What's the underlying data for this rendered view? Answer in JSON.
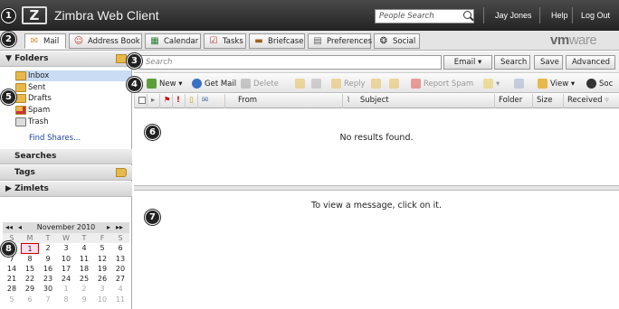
{
  "header": {
    "logo_text": "Z",
    "app_title": "Zimbra Web Client",
    "people_search_placeholder": "People Search",
    "user": "Jay Jones",
    "help": "Help",
    "logout": "Log Out"
  },
  "tabs": [
    {
      "label": "Mail",
      "icon": "mail-icon"
    },
    {
      "label": "Address Book",
      "icon": "address-book-icon"
    },
    {
      "label": "Calendar",
      "icon": "calendar-icon"
    },
    {
      "label": "Tasks",
      "icon": "tasks-icon"
    },
    {
      "label": "Briefcase",
      "icon": "briefcase-icon"
    },
    {
      "label": "Preferences",
      "icon": "preferences-icon"
    },
    {
      "label": "Social",
      "icon": "social-icon"
    }
  ],
  "brand": {
    "vm": "vm",
    "ware": "ware"
  },
  "sidebar": {
    "folders_header": "Folders",
    "folders": [
      "Inbox",
      "Sent",
      "Drafts",
      "Spam",
      "Trash"
    ],
    "find_shares": "Find Shares...",
    "searches": "Searches",
    "tags": "Tags",
    "zimlets": "Zimlets"
  },
  "calendar": {
    "month_label": "November 2010",
    "dow": [
      "S",
      "M",
      "T",
      "W",
      "T",
      "F",
      "S"
    ],
    "weeks": [
      [
        "31",
        "1",
        "2",
        "3",
        "4",
        "5",
        "6"
      ],
      [
        "7",
        "8",
        "9",
        "10",
        "11",
        "12",
        "13"
      ],
      [
        "14",
        "15",
        "16",
        "17",
        "18",
        "19",
        "20"
      ],
      [
        "21",
        "22",
        "23",
        "24",
        "25",
        "26",
        "27"
      ],
      [
        "28",
        "29",
        "30",
        "1",
        "2",
        "3",
        "4"
      ],
      [
        "5",
        "6",
        "7",
        "8",
        "9",
        "10",
        "11"
      ]
    ],
    "today": "1"
  },
  "search": {
    "placeholder": "Search",
    "scope": "Email",
    "search_btn": "Search",
    "save_btn": "Save",
    "advanced_btn": "Advanced"
  },
  "toolbar": {
    "new": "New",
    "get_mail": "Get Mail",
    "delete": "Delete",
    "reply": "Reply",
    "report_spam": "Report Spam",
    "view": "View",
    "soc": "Soc"
  },
  "columns": {
    "from": "From",
    "subject": "Subject",
    "folder": "Folder",
    "size": "Size",
    "received": "Received"
  },
  "list": {
    "empty_message": "No results found."
  },
  "reading_pane": {
    "message": "To view a message, click on it."
  },
  "callouts": [
    "1",
    "2",
    "3",
    "4",
    "5",
    "6",
    "7",
    "8"
  ],
  "colors": {
    "header_bg": "#2b2b2b",
    "selected": "#c9dcf4",
    "folder": "#e8b84a"
  }
}
